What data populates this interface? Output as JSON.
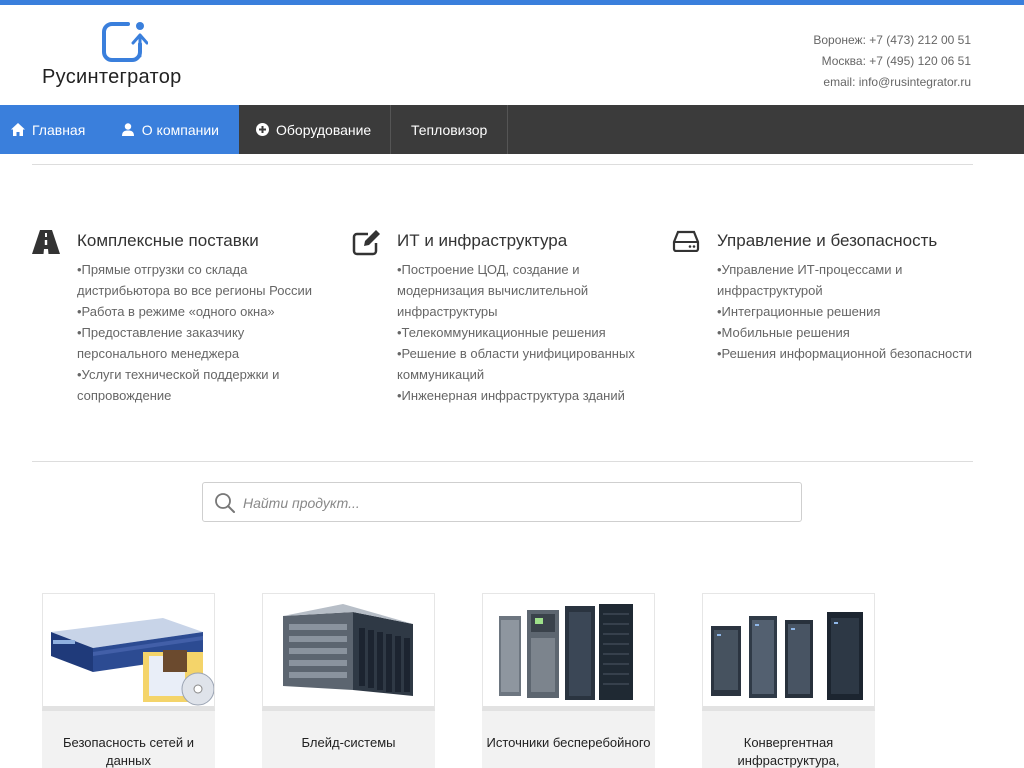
{
  "brand": {
    "name": "Русинтегратор",
    "accent_color": "#3a7fdc",
    "icon": "refresh-arrow-icon"
  },
  "contacts": {
    "voronezh": "Воронеж: +7 (473) 212 00 51",
    "moscow": "Москва: +7 (495) 120 06 51",
    "email": "email: info@rusintegrator.ru"
  },
  "nav": {
    "items": [
      {
        "label": "Главная",
        "icon": "home-icon",
        "active": true
      },
      {
        "label": "О компании",
        "icon": "user-icon",
        "active": true
      },
      {
        "label": "Оборудование",
        "icon": "plus-circle-icon",
        "active": false
      },
      {
        "label": "Тепловизор",
        "icon": "",
        "active": false
      }
    ],
    "background": "#3b3b3b"
  },
  "features": [
    {
      "icon": "road-icon",
      "title": "Комплексные поставки",
      "items": [
        "•Прямые отгрузки со склада дистрибьютора во все регионы России",
        "•Работа в режиме «одного окна»",
        "•Предоставление заказчику персонального менеджера",
        "•Услуги технической поддержки и сопровождение"
      ]
    },
    {
      "icon": "edit-icon",
      "title": "ИТ и инфраструктура",
      "items": [
        "•Построение ЦОД, создание и модернизация вычислительной инфраструктуры",
        "•Телекоммуникационные решения",
        "•Решение в области унифицированных коммуникаций",
        "•Инженерная инфраструктура зданий"
      ]
    },
    {
      "icon": "hard-drive-icon",
      "title": "Управление и безопасность",
      "items": [
        "•Управление ИТ-процессами и инфраструктурой",
        "•Интеграционные решения",
        "•Мобильные решения",
        "•Решения информационной безопасности"
      ]
    }
  ],
  "search": {
    "placeholder": "Найти продукт...",
    "icon": "search-icon"
  },
  "products": [
    {
      "name": "Безопасность сетей и данных",
      "image": "network-appliance-image"
    },
    {
      "name": "Блейд-системы",
      "image": "blade-chassis-image"
    },
    {
      "name": "Источники бесперебойного",
      "image": "ups-racks-image"
    },
    {
      "name": "Конвергентная инфраструктура,",
      "image": "server-racks-image"
    }
  ]
}
